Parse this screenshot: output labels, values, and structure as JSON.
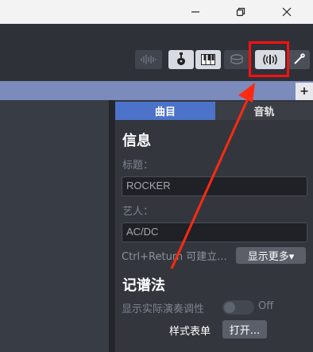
{
  "window": {
    "minimize_glyph": "—",
    "maximize_glyph": "⧉",
    "close_glyph": "✕"
  },
  "toolbar": {
    "icons": [
      "audio-wave-icon",
      "guitar-icon",
      "piano-icon",
      "drum-icon",
      "tuner-icon",
      "tools-icon"
    ]
  },
  "tabs": {
    "song": "曲目",
    "track": "音轨"
  },
  "plus_label": "+",
  "info": {
    "title": "信息",
    "title_label": "标题：",
    "title_value": "ROCKER",
    "artist_label": "艺人：",
    "artist_value": "AC/DC",
    "hint": "Ctrl+Return 可建立...",
    "more_button": "显示更多▾"
  },
  "notation": {
    "title": "记谱法",
    "show_pitch_label": "显示实际演奏调性",
    "show_pitch_state": "Off",
    "style_label": "样式表单",
    "open_button": "打开..."
  },
  "colors": {
    "highlight": "#ff1010",
    "active_tab": "#4c73c9",
    "arrow": "#ff2a10"
  }
}
